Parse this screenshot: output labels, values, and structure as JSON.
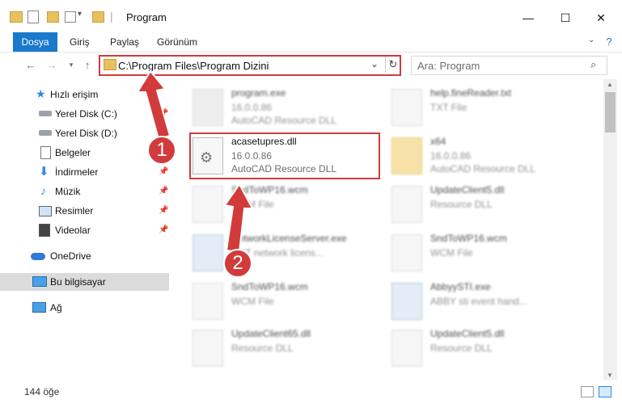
{
  "window": {
    "title": "Program"
  },
  "ribbon": {
    "tabs": [
      "Dosya",
      "Giriş",
      "Paylaş",
      "Görünüm"
    ]
  },
  "address": {
    "path": "C:\\Program Files\\Program Dizini"
  },
  "search": {
    "placeholder": "Ara: Program"
  },
  "nav": {
    "items": [
      {
        "label": "Hızlı erişim",
        "icon": "star-icon"
      },
      {
        "label": "Yerel Disk (C:)",
        "icon": "drive-icon"
      },
      {
        "label": "Yerel Disk (D:)",
        "icon": "drive-icon"
      },
      {
        "label": "Belgeler",
        "icon": "document-icon"
      },
      {
        "label": "İndirmeler",
        "icon": "download-icon"
      },
      {
        "label": "Müzik",
        "icon": "music-icon"
      },
      {
        "label": "Resimler",
        "icon": "pictures-icon"
      },
      {
        "label": "Videolar",
        "icon": "video-icon"
      },
      {
        "label": "OneDrive",
        "icon": "cloud-icon"
      },
      {
        "label": "Bu bilgisayar",
        "icon": "computer-icon"
      },
      {
        "label": "Ağ",
        "icon": "network-icon"
      }
    ]
  },
  "files": [
    {
      "name": "program.exe",
      "version": "16.0.0.86",
      "desc": "AutoCAD Resource DLL"
    },
    {
      "name": "help.fineReader.txt",
      "version": "TXT File",
      "desc": ""
    },
    {
      "name": "acasetupres.dll",
      "version": "16.0.0.86",
      "desc": "AutoCAD Resource DLL"
    },
    {
      "name": "x64",
      "version": "16.0.0.86",
      "desc": "AutoCAD Resource DLL"
    },
    {
      "name": "SndToWP16.wcm",
      "version": "WCM File",
      "desc": ""
    },
    {
      "name": "UpdateClient5.dll",
      "version": "Resource DLL",
      "desc": ""
    },
    {
      "name": "NetworkLicenseServer.exe",
      "version": "CNT network licens...",
      "desc": ""
    },
    {
      "name": "SndToWP16.wcm",
      "version": "WCM File",
      "desc": ""
    },
    {
      "name": "SndToWP16.wcm",
      "version": "WCM File",
      "desc": ""
    },
    {
      "name": "AbbyySTI.exe",
      "version": "ABBY sti event hand...",
      "desc": ""
    },
    {
      "name": "UpdateClient65.dll",
      "version": "Resource DLL",
      "desc": ""
    },
    {
      "name": "UpdateClient5.dll",
      "version": "Resource DLL",
      "desc": ""
    }
  ],
  "status": {
    "count": "144 öğe"
  },
  "callouts": [
    "1",
    "2"
  ]
}
